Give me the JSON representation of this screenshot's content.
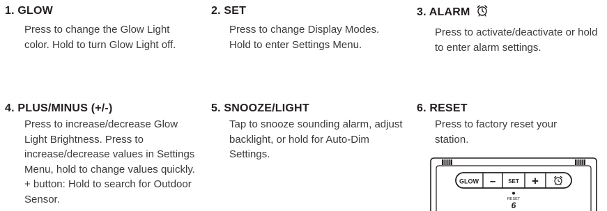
{
  "items": [
    {
      "title": "1. GLOW",
      "text": "Press to change the Glow Light color. Hold to turn Glow Light off."
    },
    {
      "title": "2. SET",
      "text": "Press to change Display Modes. Hold to enter Settings Menu."
    },
    {
      "title": "3. ALARM",
      "icon": "alarm-clock-icon",
      "text": "Press to activate/deactivate or hold to enter alarm settings."
    },
    {
      "title": "4. PLUS/MINUS (+/-)",
      "text": "Press to increase/decrease Glow Light Brightness. Press to increase/decrease values in Settings Menu, hold to change values quickly. + button: Hold to search for Outdoor Sensor."
    },
    {
      "title": "5. SNOOZE/LIGHT",
      "text": "Tap to snooze sounding alarm, adjust backlight, or hold for Auto-Dim Settings."
    },
    {
      "title": "6. RESET",
      "text": "Press to factory reset your station."
    }
  ],
  "device": {
    "buttons": {
      "glow": "GLOW",
      "minus": "–",
      "set": "SET",
      "plus": "+",
      "alarm_icon": "alarm-clock-icon"
    },
    "reset_label": "RESET",
    "reset_number": "6"
  }
}
